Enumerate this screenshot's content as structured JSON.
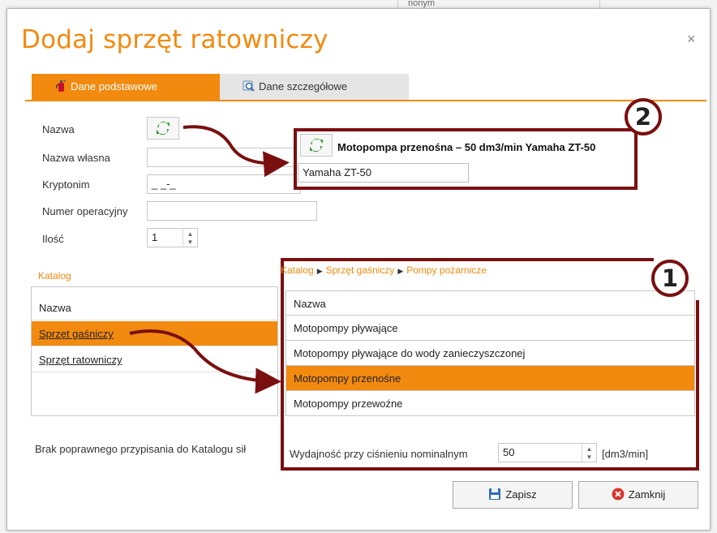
{
  "background": {
    "cell_text": "nonym"
  },
  "dialog": {
    "title": "Dodaj sprzęt ratowniczy",
    "close_glyph": "×",
    "accent_color": "#f28a10",
    "callout_color": "#7a0f0f"
  },
  "tabs": [
    {
      "label": "Dane podstawowe",
      "icon": "fire-extinguisher-icon",
      "active": true
    },
    {
      "label": "Dane szczegółowe",
      "icon": "magnifier-icon",
      "active": false
    }
  ],
  "form": {
    "nazwa_label": "Nazwa",
    "nazwa_wlasna_label": "Nazwa własna",
    "nazwa_wlasna_value": "",
    "kryptonim_label": "Kryptonim",
    "kryptonim_value": "_ _-_",
    "numer_label": "Numer operacyjny",
    "numer_value": "",
    "ilosc_label": "Ilość",
    "ilosc_value": "1"
  },
  "catalog": {
    "label": "Katalog",
    "header": "Nazwa",
    "rows": [
      {
        "label": "Sprzęt gaśniczy",
        "selected": true
      },
      {
        "label": "Sprzęt ratowniczy",
        "selected": false
      }
    ]
  },
  "bottom_text": "Brak poprawnego przypisania do Katalogu sił",
  "callout_1": {
    "number": "1",
    "breadcrumb": [
      "Katalog",
      "Sprzęt gaśniczy",
      "Pompy pożarnicze"
    ],
    "header": "Nazwa",
    "rows": [
      {
        "label": "Motopompy pływające",
        "selected": false
      },
      {
        "label": "Motopompy pływające do wody zanieczyszczonej",
        "selected": false
      },
      {
        "label": "Motopompy przenośne",
        "selected": true
      },
      {
        "label": "Motopompy przewoźne",
        "selected": false
      }
    ],
    "capacity_label": "Wydajność przy ciśnieniu nominalnym",
    "capacity_value": "50",
    "capacity_unit": "[dm3/min]"
  },
  "callout_2": {
    "number": "2",
    "title": "Motopompa przenośna – 50 dm3/min Yamaha ZT-50",
    "own_name_value": "Yamaha ZT-50"
  },
  "buttons": {
    "save": "Zapisz",
    "close": "Zamknij"
  }
}
